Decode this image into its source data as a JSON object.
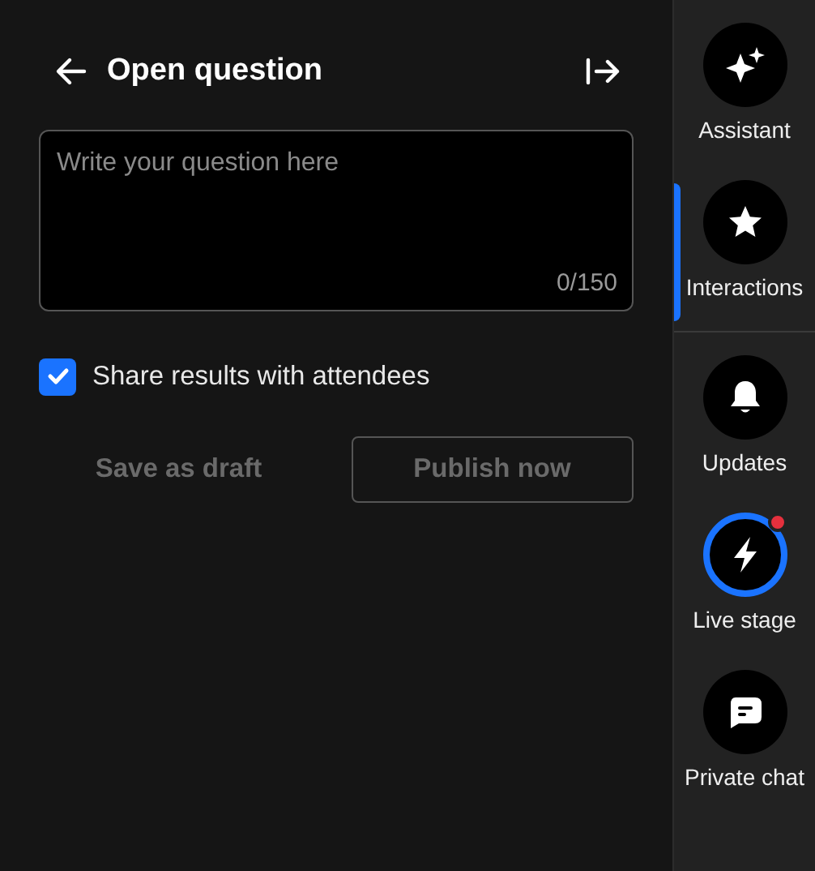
{
  "header": {
    "title": "Open question"
  },
  "question_field": {
    "placeholder": "Write your question here",
    "counter": "0/150"
  },
  "share_checkbox": {
    "label": "Share results with attendees",
    "checked": true
  },
  "buttons": [
    {
      "label": "Save as draft",
      "kind": "text",
      "disabled": true
    },
    {
      "label": "Publish now",
      "kind": "outline",
      "disabled": true
    }
  ],
  "sidebar": {
    "items": [
      {
        "label": "Assistant",
        "selected": false,
        "live": false,
        "notification": false
      },
      {
        "label": "Interactions",
        "selected": true,
        "live": false,
        "notification": false
      },
      {
        "label": "Updates",
        "selected": false,
        "live": false,
        "notification": false
      },
      {
        "label": "Live stage",
        "selected": false,
        "live": true,
        "notification": true
      },
      {
        "label": "Private chat",
        "selected": false,
        "live": false,
        "notification": false
      }
    ]
  }
}
